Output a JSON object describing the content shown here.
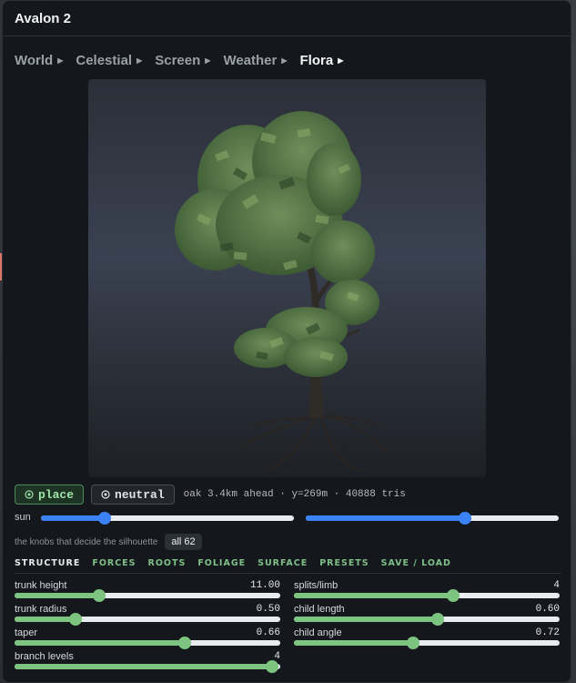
{
  "window": {
    "title": "Avalon 2"
  },
  "tabs": [
    {
      "label": "World",
      "active": false
    },
    {
      "label": "Celestial",
      "active": false
    },
    {
      "label": "Screen",
      "active": false
    },
    {
      "label": "Weather",
      "active": false
    },
    {
      "label": "Flora",
      "active": true
    }
  ],
  "toolbar": {
    "place_icon": "target-icon",
    "place_label": "place",
    "neutral_icon": "target-icon",
    "neutral_label": "neutral",
    "status": "oak 3.4km ahead · y=269m · 40888 tris"
  },
  "sun": {
    "label": "sun",
    "left_value": 0.25,
    "right_value": 0.63
  },
  "hint": {
    "text": "the knobs that decide the silhouette",
    "chip": "all 62"
  },
  "sections": [
    "STRUCTURE",
    "FORCES",
    "ROOTS",
    "FOLIAGE",
    "SURFACE",
    "PRESETS",
    "SAVE / LOAD"
  ],
  "active_section": "STRUCTURE",
  "params": {
    "trunk_height": {
      "label": "trunk height",
      "value": "11.00",
      "level": 0.32
    },
    "trunk_radius": {
      "label": "trunk radius",
      "value": "0.50",
      "level": 0.23
    },
    "taper": {
      "label": "taper",
      "value": "0.66",
      "level": 0.64
    },
    "branch_levels": {
      "label": "branch levels",
      "value": "4",
      "level": 0.97
    },
    "splits_limb": {
      "label": "splits/limb",
      "value": "4",
      "level": 0.6
    },
    "child_length": {
      "label": "child length",
      "value": "0.60",
      "level": 0.54
    },
    "child_angle": {
      "label": "child angle",
      "value": "0.72",
      "level": 0.45
    }
  },
  "colors": {
    "accent_blue": "#3b82f6",
    "accent_green": "#7cc47f",
    "side_tab": "#d97766"
  }
}
